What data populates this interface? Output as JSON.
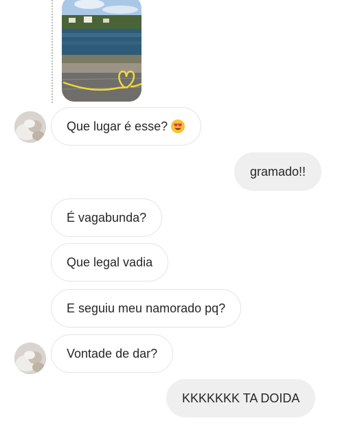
{
  "thread": {
    "story_reply": {
      "thumbnail_icon": "story-photo",
      "line_color": "#b7b7b7"
    },
    "messages": [
      {
        "id": "m1",
        "side": "incoming",
        "text": "Que lugar é esse?",
        "emoji": "heart-eyes-emoji",
        "avatar": true
      },
      {
        "id": "m2",
        "side": "outgoing",
        "text": "gramado!!"
      },
      {
        "id": "m3",
        "side": "incoming",
        "text": "É vagabunda?"
      },
      {
        "id": "m4",
        "side": "incoming",
        "text": "Que legal vadia"
      },
      {
        "id": "m5",
        "side": "incoming",
        "text": "E seguiu meu namorado pq?"
      },
      {
        "id": "m6",
        "side": "incoming",
        "text": "Vontade de dar?",
        "avatar": true
      },
      {
        "id": "m7",
        "side": "outgoing",
        "text": "KKKKKKK TA DOIDA"
      }
    ],
    "colors": {
      "incoming_bubble": "#ffffff",
      "incoming_border": "#e3e3e3",
      "outgoing_bubble": "#efefef",
      "text": "#262626",
      "heart_line": "#f2d83a"
    }
  }
}
